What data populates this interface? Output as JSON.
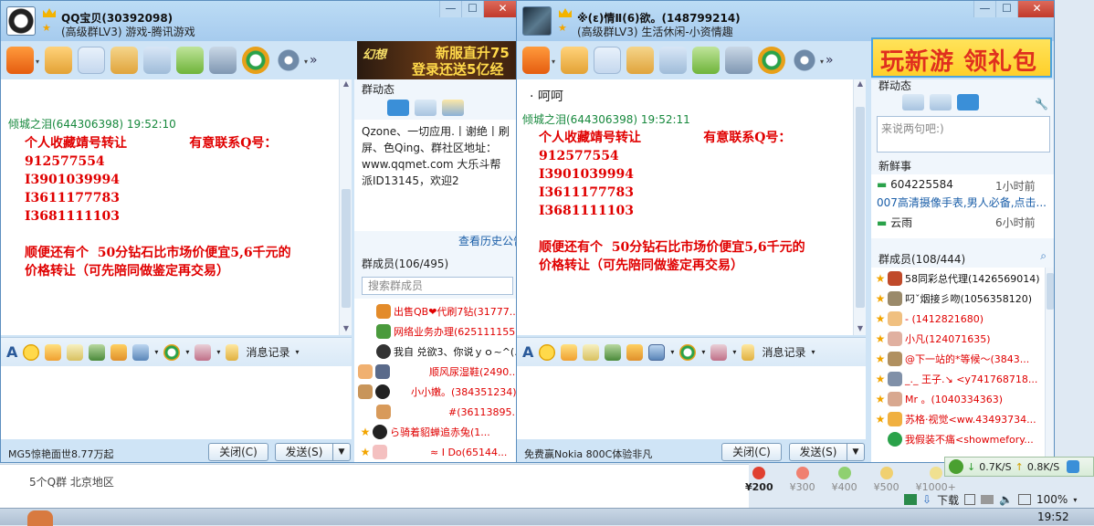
{
  "window1": {
    "title": "QQ宝贝(30392098)",
    "subtitle": "(高级群LV3) 游戏-腾讯游戏",
    "chat": {
      "sender": "倾城之泪(644306398)",
      "time": "19:52:10",
      "lines": [
        "个人收藏靖号转让              有意联系Q号：",
        "912577554",
        "I3901039994",
        "I3611177783",
        "I3681111103",
        "",
        "顺便还有个  50分钻石比市场价便宜5,6千元的",
        "价格转让（可先陪同做鉴定再交易）"
      ]
    },
    "format_history": "消息记录",
    "ad_text": "MG5惊艳面世8.77万起",
    "close_label": "关闭(C)",
    "send_label": "发送(S)",
    "side": {
      "dynamic_title": "群动态",
      "notice": "Qzone、一切应用.丨谢绝丨刷屏、色Qing、群社区地址：www.qqmet.com 大乐斗帮派ID13145，欢迎2",
      "history_link": "查看历史公告",
      "members_title": "群成员(106/495)",
      "search_placeholder": "搜索群成员",
      "members": [
        "出售QB❤代刷7钻(31777...",
        "网络业务办理(625111155)",
        "我自 兑欲3、你说ｙｏ~^(...",
        "顺风尿湿鞋(2490...",
        "小小嫩。(384351234)",
        "#(36113895...",
        "ら骑着貂蝉追赤兔(1...",
        "≈  I  Do(65144..."
      ],
      "ad_line1": "新服直升75",
      "ad_line2": "登录还送5亿经",
      "ad_logo": "幻想"
    },
    "footer": {
      "groups": "5个Q群",
      "region": "北京地区"
    }
  },
  "window2": {
    "title": "※(ε)情Ⅱ(6)欲。(148799214)",
    "subtitle": "(高级群LV3) 生活休闲-小资情趣",
    "chat": {
      "prev_line": "呵呵",
      "sender": "倾城之泪(644306398)",
      "time": "19:52:11",
      "lines": [
        "个人收藏靖号转让              有意联系Q号：",
        "912577554",
        "I3901039994",
        "I3611177783",
        "I3681111103",
        "",
        "顺便还有个  50分钻石比市场价便宜5,6千元的",
        "价格转让（可先陪同做鉴定再交易）"
      ]
    },
    "format_history": "消息记录",
    "ad_text": "免费赢Nokia 800C体验非凡",
    "close_label": "关闭(C)",
    "send_label": "发送(S)",
    "side": {
      "banner": "玩新游 领礼包",
      "dynamic_title": "群动态",
      "say_placeholder": "来说两句吧:)",
      "news_title": "新鲜事",
      "news": [
        {
          "user": "604225584",
          "time": "1小时前",
          "text": "007高清摄像手表,男人必备,点击..."
        },
        {
          "user": "云雨",
          "time": "6小时前",
          "text": ""
        }
      ],
      "members_title": "群成员(108/444)",
      "members": [
        "58同彩总代理(1426569014)",
        "叼ˇ烟接彡吻(1056358120)",
        "-    (1412821680)",
        "小凡(124071635)",
        "@下一站的*等候～(3843...",
        "_._ 王子.↘ <y741768718...",
        "Mr 。(1040334363)",
        "苏格·视觉<ww.43493734...",
        "我假装不痛<showmefory..."
      ]
    }
  },
  "footer_gifts": [
    "¥200",
    "¥300",
    "¥400",
    "¥500",
    "¥1000+"
  ],
  "net": {
    "down": "0.7K/S",
    "up": "0.8K/S"
  },
  "status": {
    "download": "下载",
    "zoom": "100%"
  },
  "clock": "19:52"
}
